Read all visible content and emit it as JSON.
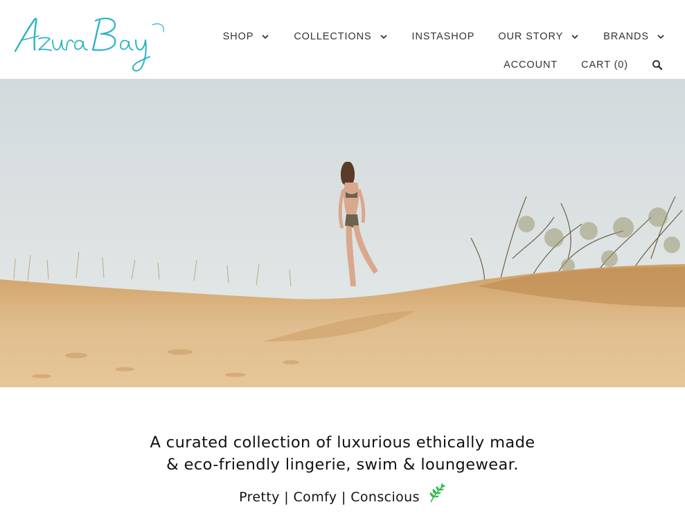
{
  "brand": {
    "logo_text": "Azura Bay",
    "logo_color": "#29b4c4"
  },
  "nav": {
    "top": [
      {
        "label": "SHOP",
        "dropdown": true
      },
      {
        "label": "COLLECTIONS",
        "dropdown": true
      },
      {
        "label": "INSTASHOP",
        "dropdown": false
      },
      {
        "label": "OUR STORY",
        "dropdown": true
      },
      {
        "label": "BRANDS",
        "dropdown": true
      }
    ],
    "bottom": {
      "account": "ACCOUNT",
      "cart": "CART (0)",
      "search_icon": "search-icon"
    }
  },
  "hero": {
    "scene": "sand-dune-sky-woman",
    "sky_color": "#dce2e3",
    "sand_color": "#d8b07c"
  },
  "intro": {
    "line1": "A curated collection of luxurious ethically made",
    "line2": "& eco-friendly lingerie, swim & loungewear.",
    "motto": "Pretty | Comfy | Conscious",
    "motto_icon": "leaf-icon",
    "leaf_color": "#2fb84a"
  }
}
